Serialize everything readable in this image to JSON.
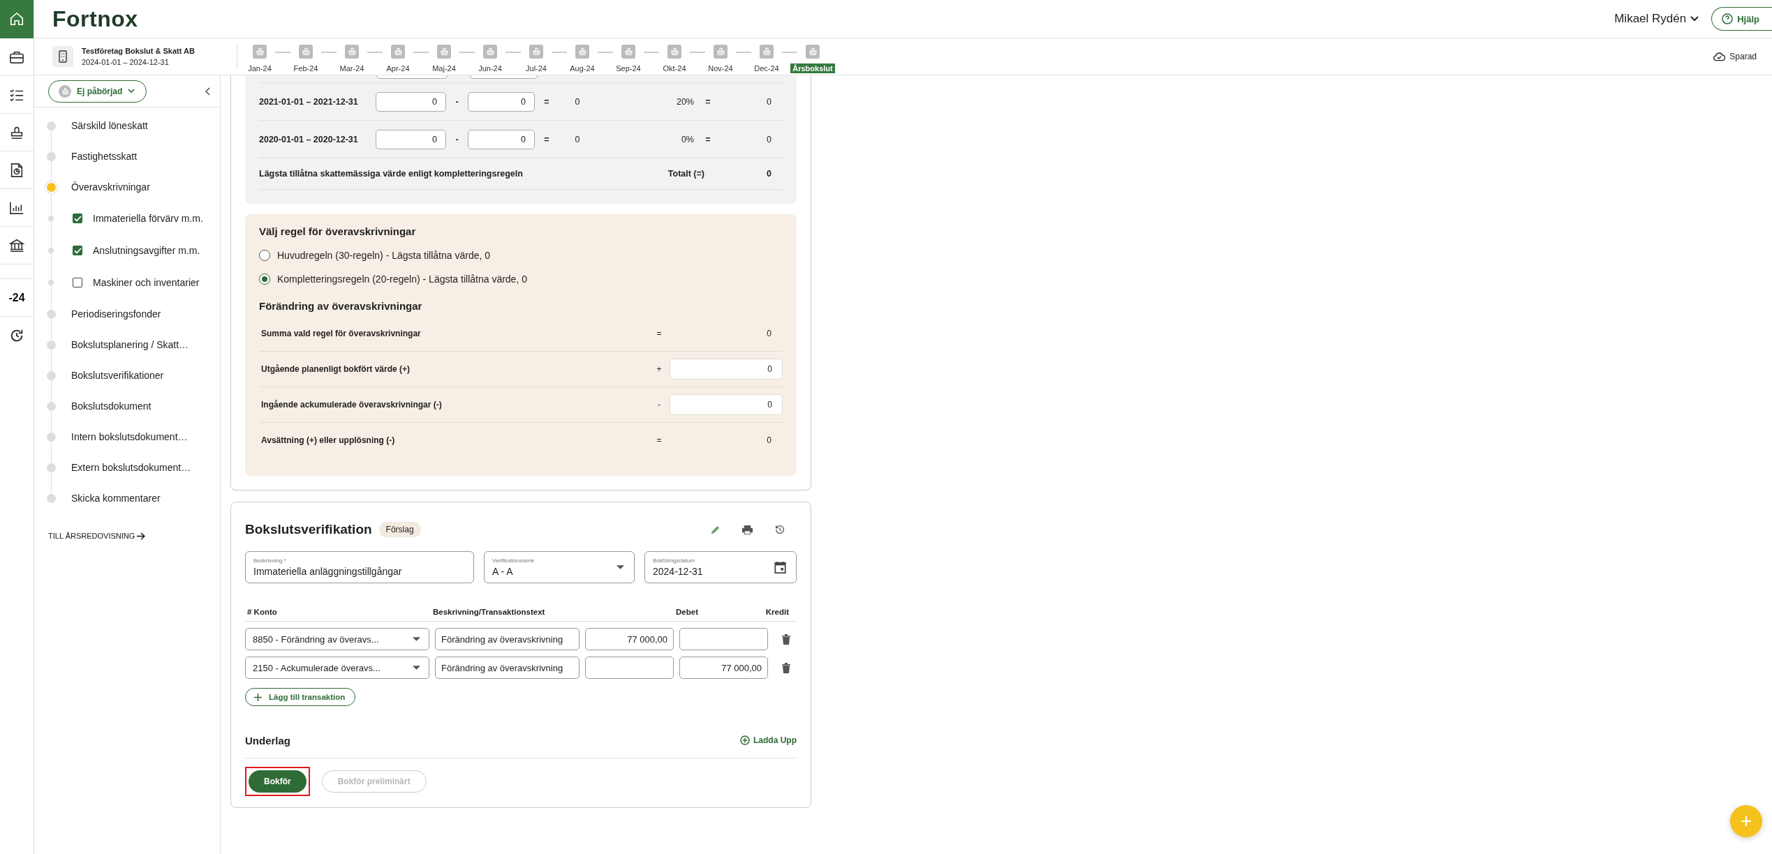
{
  "rail": [
    {
      "kind": "home",
      "selected": true
    },
    {
      "kind": "briefcase"
    },
    {
      "kind": "checklist"
    },
    {
      "kind": "stamp"
    },
    {
      "kind": "document"
    },
    {
      "kind": "chart"
    },
    {
      "kind": "bank"
    },
    {
      "kind": "spacer"
    },
    {
      "kind": "year",
      "label": "-24"
    },
    {
      "kind": "history"
    }
  ],
  "header": {
    "logo": "Fortnox",
    "user": "Mikael Rydén",
    "help": "Hjälp"
  },
  "company": {
    "name": "Testföretag Bokslut & Skatt AB",
    "period": "2024-01-01 – 2024-12-31"
  },
  "timeline": [
    {
      "label": "Jan-24",
      "selected": false
    },
    {
      "label": "Feb-24",
      "selected": false
    },
    {
      "label": "Mar-24",
      "selected": false
    },
    {
      "label": "Apr-24",
      "selected": false
    },
    {
      "label": "Maj-24",
      "selected": false
    },
    {
      "label": "Jun-24",
      "selected": false
    },
    {
      "label": "Jul-24",
      "selected": false
    },
    {
      "label": "Aug-24",
      "selected": false
    },
    {
      "label": "Sep-24",
      "selected": false
    },
    {
      "label": "Okt-24",
      "selected": false
    },
    {
      "label": "Nov-24",
      "selected": false
    },
    {
      "label": "Dec-24",
      "selected": false
    },
    {
      "label": "Årsbokslut",
      "selected": true
    }
  ],
  "save_status": "Sparad",
  "sidebar": {
    "status": "Ej påbörjad",
    "items": [
      {
        "label": "Särskild löneskatt",
        "selected": false
      },
      {
        "label": "Fastighetsskatt",
        "selected": false
      },
      {
        "label": "Överavskrivningar",
        "selected": true,
        "children": [
          {
            "label": "Immateriella förvärv m.m.",
            "checked": true
          },
          {
            "label": "Anslutningsavgifter m.m.",
            "checked": true
          },
          {
            "label": "Maskiner och inventarier",
            "checked": false
          }
        ]
      },
      {
        "label": "Periodiseringsfonder",
        "selected": false
      },
      {
        "label": "Bokslutsplanering / Skatt…",
        "selected": false
      },
      {
        "label": "Bokslutsverifikationer",
        "selected": false
      },
      {
        "label": "Bokslutsdokument",
        "selected": false
      },
      {
        "label": "Intern bokslutsdokument…",
        "selected": false
      },
      {
        "label": "Extern bokslutsdokument…",
        "selected": false
      },
      {
        "label": "Skicka kommentarer",
        "selected": false
      }
    ],
    "link": "TILL ÅRSREDOVISNING"
  },
  "rule_table": {
    "rows": [
      {
        "period": "2021-01-01 – 2021-12-31",
        "value_a": "0",
        "minus": "-",
        "value_b": "0",
        "equals": "=",
        "result": "0",
        "percent": "20%",
        "equals_2": "=",
        "amount": "0"
      },
      {
        "period": "2020-01-01 – 2020-12-31",
        "value_a": "0",
        "minus": "-",
        "value_b": "0",
        "equals": "=",
        "result": "0",
        "percent": "0%",
        "equals_2": "=",
        "amount": "0"
      }
    ],
    "total": {
      "label": "Lägsta tillåtna skattemässiga värde enligt kompletteringsregeln",
      "total_label": "Totalt (=)",
      "value": "0"
    }
  },
  "rule_choice": {
    "title": "Välj regel för överavskrivningar",
    "options": [
      {
        "label": "Huvudregeln (30-regeln) - Lägsta tillåtna värde, 0",
        "selected": false
      },
      {
        "label": "Kompletteringsregeln (20-regeln) - Lägsta tillåtna värde, 0",
        "selected": true
      }
    ]
  },
  "change": {
    "title": "Förändring av överavskrivningar",
    "rows": [
      {
        "kind": "text",
        "label": "Summa vald regel för överavskrivningar",
        "op": "=",
        "value": "0"
      },
      {
        "kind": "input",
        "label": "Utgående planenligt bokfört värde (+)",
        "op": "+",
        "value": "0"
      },
      {
        "kind": "input",
        "label": "Ingående ackumulerade överavskrivningar (-)",
        "op": "-",
        "value": "0"
      },
      {
        "kind": "text",
        "label": "Avsättning (+) eller upplösning (-)",
        "op": "=",
        "value": "0"
      }
    ]
  },
  "verification": {
    "title": "Bokslutsverifikation",
    "badge": "Förslag",
    "fields": [
      {
        "kind": "text",
        "label": "Beskrivning *",
        "value": "Immateriella anläggningstillgångar"
      },
      {
        "kind": "select",
        "label": "Verifikationsserie",
        "value": "A - A"
      },
      {
        "kind": "date",
        "label": "Bokföringsdatum",
        "value": "2024-12-31"
      }
    ],
    "columns": [
      "# Konto",
      "Beskrivning/Transaktionstext",
      "Debet",
      "Kredit"
    ],
    "rows": [
      {
        "account": "8850 -  Förändring av överavs...",
        "text": "Förändring av överavskrivning",
        "debit": "77 000,00"
      },
      {
        "account": "2150 -  Ackumulerade överavs...",
        "text": "Förändring av överavskrivning",
        "credit": "77 000,00"
      }
    ],
    "add_button": "Lägg till transaktion",
    "attachments_title": "Underlag",
    "upload": "Ladda Upp",
    "buttons": [
      {
        "kind": "primary",
        "label": "Bokför",
        "highlighted": true,
        "disabled": false
      },
      {
        "kind": "secondary",
        "label": "Bokför preliminärt",
        "highlighted": false,
        "disabled": true
      }
    ]
  }
}
